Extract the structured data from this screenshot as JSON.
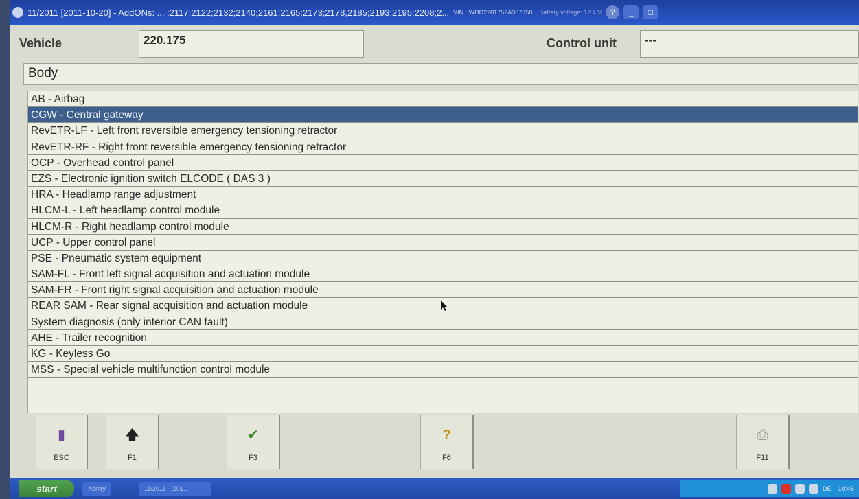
{
  "titlebar": {
    "text": "11/2011 [2011-10-20] - AddONs: ... ;2117;2122;2132;2140;2161;2165;2173;2178,2185;2193;2195;2208;2...",
    "vin": "VIN : WDD2201752A367358",
    "battery": "Battery voltage: 12.4 V",
    "min_label": "_",
    "restore_label": "□"
  },
  "vehicle": {
    "label": "Vehicle",
    "value": "220.175",
    "control_unit_label": "Control unit",
    "control_unit_value": "---"
  },
  "category": "Body",
  "list": {
    "selected_index": 1,
    "items": [
      "AB - Airbag",
      "CGW - Central gateway",
      "RevETR-LF - Left front reversible emergency tensioning retractor",
      "RevETR-RF - Right front reversible emergency tensioning retractor",
      "OCP - Overhead control panel",
      "EZS - Electronic ignition switch ELCODE ( DAS 3 )",
      "HRA - Headlamp range adjustment",
      "HLCM-L - Left headlamp control module",
      "HLCM-R - Right headlamp control module",
      "UCP - Upper control panel",
      "PSE - Pneumatic system equipment",
      "SAM-FL - Front left signal acquisition and actuation module",
      "SAM-FR - Front right signal acquisition and actuation module",
      "REAR SAM - Rear signal acquisition and actuation module",
      "System diagnosis (only interior CAN fault)",
      "AHE - Trailer recognition",
      "KG - Keyless Go",
      "MSS - Special vehicle multifunction control module"
    ]
  },
  "keys": {
    "esc": {
      "label": "ESC",
      "icon": "exit-door-icon"
    },
    "f1": {
      "label": "F1",
      "icon": "up-arrow-icon"
    },
    "f3": {
      "label": "F3",
      "icon": "checkmark-icon"
    },
    "f6": {
      "label": "F6",
      "icon": "help-question-icon"
    },
    "f11": {
      "label": "F11",
      "icon": "printer-icon"
    }
  },
  "taskbar": {
    "start": "start",
    "item1": "Xentry",
    "item2": "11/2011 - [201...",
    "tray_label": "DE",
    "clock": "10:45"
  },
  "colors": {
    "selection": "#3d5f8e",
    "titlebar": "#2a58c8",
    "background": "#d9dccf"
  }
}
